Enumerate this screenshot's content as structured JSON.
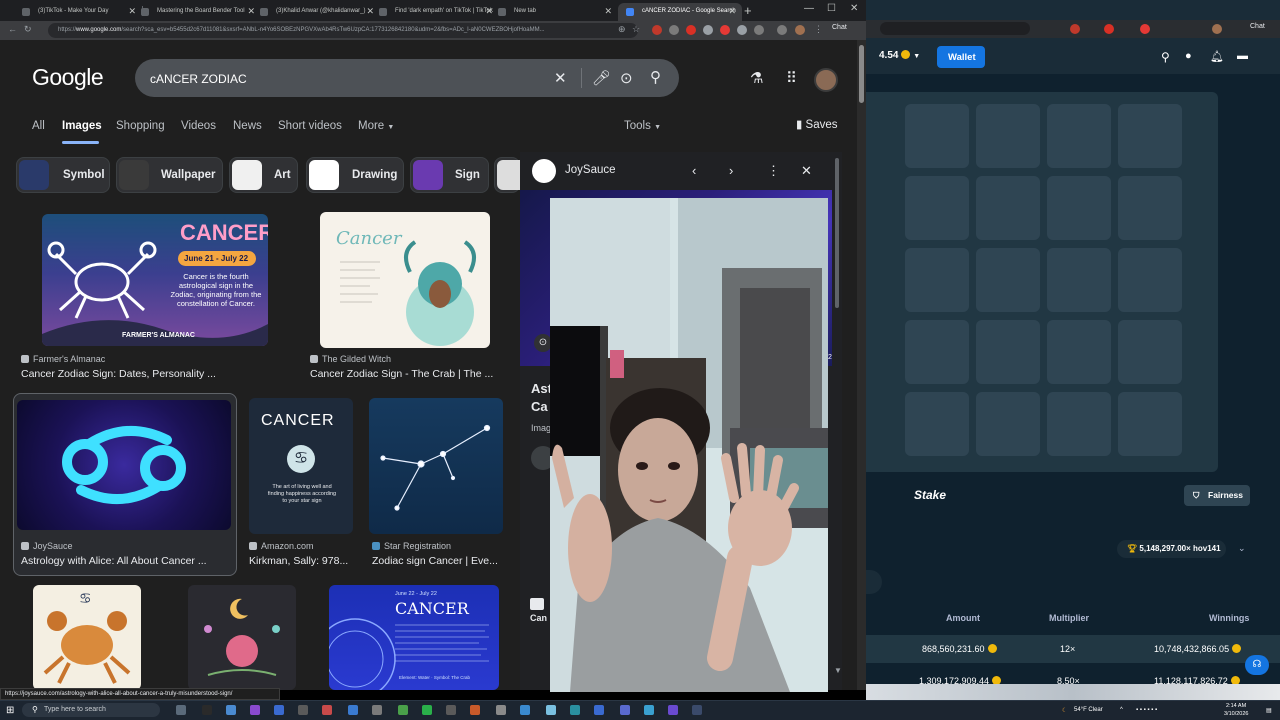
{
  "browser": {
    "tabs": [
      {
        "title": "(3)TikTok - Make Your Day",
        "active": false
      },
      {
        "title": "Mastering the Board Bender Tool",
        "active": false
      },
      {
        "title": "(3)Khalid Anwar (@khalidanwar_)",
        "active": false
      },
      {
        "title": "Find 'dark empath' on TikTok | TikTok",
        "active": false
      },
      {
        "title": "New tab",
        "active": false
      },
      {
        "title": "cANCER ZODIAC - Google Search",
        "active": true
      }
    ],
    "url_host": "www.google.com",
    "url_rest": "/search?sca_esv=b5455d2c67d11081&sxsrf=ANbL-n4Yo6SOBEzNPGVXwAb4RsTw6UzpCA:1773126842180&udm=2&fbs=ADc_l-aN0CWEZBOHjofHoaMM...",
    "chat_label": "Chat",
    "status_url": "https://joysauce.com/astrology-with-alice-all-about-cancer-a-truly-misunderstood-sign/"
  },
  "google": {
    "logo": "Google",
    "query": "cANCER ZODIAC",
    "nav_tabs": [
      "All",
      "Images",
      "Shopping",
      "Videos",
      "News",
      "Short videos",
      "More",
      "Tools"
    ],
    "saves_label": "Saves",
    "chips": [
      {
        "label": "Symbol",
        "color": "#2a3a6a"
      },
      {
        "label": "Wallpaper",
        "color": "#3a3a3a"
      },
      {
        "label": "Art",
        "color": "#f0f0f0"
      },
      {
        "label": "Drawing",
        "color": "#ffffff"
      },
      {
        "label": "Sign",
        "color": "#6a3ab0"
      }
    ],
    "results": [
      {
        "source": "Farmer's Almanac",
        "caption": "Cancer Zodiac Sign: Dates, Personality ...",
        "image_text": "CANCER",
        "image_sub": "June 21 - July 22",
        "image_body": "Cancer is the fourth astrological sign in the Zodiac, originating from the constellation of Cancer.",
        "image_footer": "FARMER'S ALMANAC"
      },
      {
        "source": "The Gilded Witch",
        "caption": "Cancer Zodiac Sign - The Crab | The ...",
        "image_text": "Cancer"
      },
      {
        "source": "JoySauce",
        "caption": "Astrology with Alice: All About Cancer ..."
      },
      {
        "source": "Amazon.com",
        "caption": "Kirkman, Sally: 978...",
        "image_text": "CANCER",
        "image_body": "The art of living well and finding happiness according to your star sign"
      },
      {
        "source": "Star Registration",
        "caption": "Zodiac sign Cancer | Eve..."
      },
      {
        "image_text": "CANCER",
        "image_sub": "June 22 - July 22",
        "image_footer": "Element: Water · Symbol: The Crab"
      }
    ],
    "panel": {
      "source": "JoySauce",
      "title_fragment": "Ast",
      "title_fragment2": "Ca",
      "label_fragment": "Imag",
      "bottom_fragment": "Can",
      "page_badge": "2"
    }
  },
  "stake": {
    "balance": "4.54",
    "wallet_label": "Wallet",
    "logo": "Stake",
    "fairness_label": "Fairness",
    "bettor": "5,148,297.00× hov141",
    "table_headers": [
      "Amount",
      "Multiplier",
      "Winnings"
    ],
    "rows": [
      {
        "amount": "868,560,231.60",
        "multiplier": "12×",
        "winnings": "10,748,432,866.05"
      },
      {
        "amount": "1,309,172,909.44",
        "multiplier": "8.50×",
        "winnings": "11,128,117,826.72"
      }
    ]
  },
  "taskbar": {
    "search_placeholder": "Type here to search",
    "weather": "54°F Clear",
    "time": "2:14 AM",
    "date": "3/10/2026"
  }
}
